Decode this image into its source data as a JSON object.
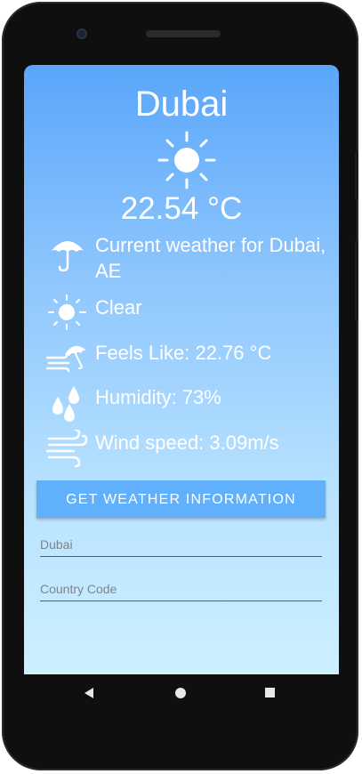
{
  "weather": {
    "city": "Dubai",
    "temperature": "22.54 °C",
    "description_line": "Current weather for Dubai, AE",
    "condition": "Clear",
    "feels_like": "Feels Like: 22.76 °C",
    "humidity": "Humidity: 73%",
    "wind_speed": "Wind speed: 3.09m/s"
  },
  "icons": {
    "main": "sun-icon",
    "description": "umbrella-icon",
    "condition": "sun-icon",
    "feels_like": "wind-umbrella-icon",
    "humidity": "water-drops-icon",
    "wind": "wind-icon"
  },
  "action_button": {
    "label": "GET WEATHER INFORMATION"
  },
  "form": {
    "city_value": "Dubai",
    "country_placeholder": "Country Code"
  },
  "colors": {
    "gradient_top": "#5aa6fb",
    "gradient_bottom": "#cdf0ff",
    "button": "#60b0fb"
  }
}
